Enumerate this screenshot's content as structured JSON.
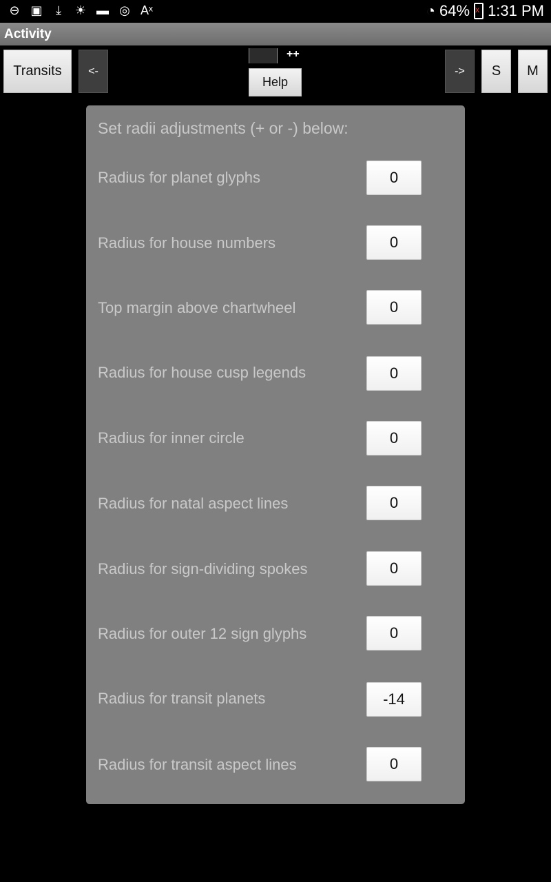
{
  "status_bar": {
    "icons": [
      "dnd-icon",
      "image-icon",
      "download-icon",
      "brightness-icon",
      "folder-icon",
      "sync-icon",
      "translate-icon"
    ],
    "battery": "64%",
    "time": "1:31 PM"
  },
  "title_bar": {
    "title": "Activity"
  },
  "toolbar": {
    "transits_label": "Transits",
    "back_label": "<-",
    "forward_label": "->",
    "help_label": "Help",
    "plus_label": "++",
    "s_label": "S",
    "m_label": "M"
  },
  "panel": {
    "header": "Set radii adjustments (+ or -) below:",
    "rows": [
      {
        "label": "Radius for planet glyphs",
        "value": "0"
      },
      {
        "label": "Radius for house numbers",
        "value": "0"
      },
      {
        "label": "Top margin above chartwheel",
        "value": "0"
      },
      {
        "label": "Radius for house cusp legends",
        "value": "0"
      },
      {
        "label": "Radius for inner circle",
        "value": "0"
      },
      {
        "label": "Radius for natal aspect lines",
        "value": "0"
      },
      {
        "label": "Radius for sign-dividing spokes",
        "value": "0"
      },
      {
        "label": "Radius for outer 12 sign glyphs",
        "value": "0"
      },
      {
        "label": "Radius for transit planets",
        "value": "-14"
      },
      {
        "label": "Radius for transit aspect lines",
        "value": "0"
      }
    ]
  }
}
